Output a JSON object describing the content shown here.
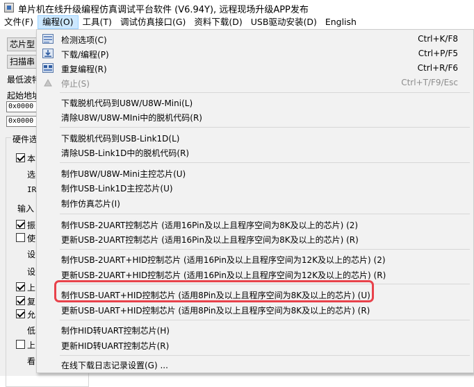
{
  "window": {
    "title": "单片机在线升级编程仿真调试平台软件 (V6.94Y), 远程现场升级APP发布"
  },
  "menubar": {
    "items": [
      {
        "label": "文件(F)"
      },
      {
        "label": "编程(O)"
      },
      {
        "label": "工具(T)"
      },
      {
        "label": "调试仿真接口(G)"
      },
      {
        "label": "资料下载(D)"
      },
      {
        "label": "USB驱动安装(D)"
      },
      {
        "label": "English"
      }
    ]
  },
  "background": {
    "chip_type_button": "芯片型",
    "scan_button": "扫描串",
    "min_baud_label": "最低波特",
    "start_addr_label": "起始地址",
    "addr1": "0x0000",
    "addr2": "0x0000",
    "hw_group_title": "硬件选",
    "options": [
      {
        "text": "本",
        "checked": true
      },
      {
        "text": "选",
        "checked": null
      },
      {
        "text": "IR",
        "checked": null
      },
      {
        "text": "输入",
        "checked": null
      },
      {
        "text": "振",
        "checked": true
      },
      {
        "text": "使",
        "checked": false
      },
      {
        "text": "设",
        "checked": null
      },
      {
        "text": "设",
        "checked": null
      },
      {
        "text": "上",
        "checked": true
      },
      {
        "text": "复",
        "checked": true
      },
      {
        "text": "允",
        "checked": true
      },
      {
        "text": "低",
        "checked": null
      },
      {
        "text": "上",
        "checked": false
      },
      {
        "text": "看",
        "checked": null
      }
    ]
  },
  "program_menu": {
    "items": [
      {
        "label": "检测选项(C)",
        "shortcut": "Ctrl+K/F8",
        "icon": "detect-icon",
        "disabled": false
      },
      {
        "label": "下载/编程(P)",
        "shortcut": "Ctrl+P/F5",
        "icon": "download-icon",
        "disabled": false
      },
      {
        "label": "重复编程(R)",
        "shortcut": "Ctrl+R/F6",
        "icon": "repeat-icon",
        "disabled": false
      },
      {
        "label": "停止(S)",
        "shortcut": "Ctrl+T/F9/Esc",
        "icon": "stop-icon",
        "disabled": true
      },
      {
        "label": "下载脱机代码到U8W/U8W-Mini(L)",
        "shortcut": ""
      },
      {
        "label": "清除U8W/U8W-MIni中的脱机代码(R)",
        "shortcut": ""
      },
      {
        "label": "下载脱机代码到USB-Link1D(L)",
        "shortcut": ""
      },
      {
        "label": "清除USB-Link1D中的脱机代码(R)",
        "shortcut": ""
      },
      {
        "label": "制作U8W/U8W-Mini主控芯片(U)",
        "shortcut": ""
      },
      {
        "label": "制作USB-Link1D主控芯片(U)",
        "shortcut": ""
      },
      {
        "label": "制作仿真芯片(I)",
        "shortcut": ""
      },
      {
        "label": "制作USB-2UART控制芯片 (适用16Pin及以上且程序空间为8K及以上的芯片) (2)",
        "shortcut": ""
      },
      {
        "label": "更新USB-2UART控制芯片 (适用16Pin及以上且程序空间为8K及以上的芯片) (R)",
        "shortcut": ""
      },
      {
        "label": "制作USB-2UART+HID控制芯片 (适用16Pin及以上且程序空间为12K及以上的芯片) (2)",
        "shortcut": ""
      },
      {
        "label": "更新USB-2UART+HID控制芯片 (适用16Pin及以上且程序空间为12K及以上的芯片) (R)",
        "shortcut": ""
      },
      {
        "label": "制作USB-UART+HID控制芯片 (适用8Pin及以上且程序空间为8K及以上的芯片) (U)",
        "shortcut": ""
      },
      {
        "label": "更新USB-UART+HID控制芯片 (适用8Pin及以上且程序空间为8K及以上的芯片) (R)",
        "shortcut": ""
      },
      {
        "label": "制作HID转UART控制芯片(H)",
        "shortcut": ""
      },
      {
        "label": "更新HID转UART控制芯片(R)",
        "shortcut": ""
      },
      {
        "label": "在线下载日志记录设置(G) ...",
        "shortcut": ""
      }
    ]
  },
  "colors": {
    "highlight_border": "#e8424b",
    "menu_active_bg": "#cce8ff",
    "menu_bg": "#f2f2f2",
    "disabled_text": "#8c8c8c"
  }
}
